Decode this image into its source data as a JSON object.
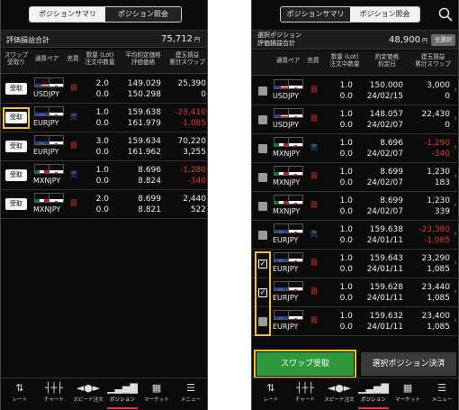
{
  "colors": {
    "buy": "#e53935",
    "sell": "#5c7bd9",
    "negative": "#e53935",
    "highlight": "#f6c417",
    "primary_button": "#2f9a3c"
  },
  "left": {
    "tabs": [
      {
        "label": "ポジションサマリ",
        "active": true
      },
      {
        "label": "ポジション照会",
        "active": false
      }
    ],
    "summary": {
      "label": "評価損益合計",
      "value": "75,712",
      "unit": "円"
    },
    "headers": {
      "swap": [
        "スワップ",
        "受取り"
      ],
      "pair": "通貨ペア",
      "side": "売買",
      "qty": [
        "数量 (Lot)",
        "注文中数量"
      ],
      "price": [
        "平均約定価格",
        "評価価格"
      ],
      "pl": [
        "建玉損益",
        "累計スワップ"
      ]
    },
    "rows": [
      {
        "button": "受取",
        "pair": "USDJPY",
        "flags": [
          "us",
          "jp"
        ],
        "side": "買",
        "side_type": "buy",
        "qty": "2.0",
        "pending": "0.0",
        "price1": "149.029",
        "price2": "150.298",
        "pl": "25,390",
        "swap": "0",
        "pl_neg": false,
        "swap_neg": false,
        "highlighted": false
      },
      {
        "button": "受取",
        "pair": "EURJPY",
        "flags": [
          "eu",
          "jp"
        ],
        "side": "売",
        "side_type": "sell",
        "qty": "1.0",
        "pending": "0.0",
        "price1": "159.638",
        "price2": "161.979",
        "pl": "-23,410",
        "swap": "-1,085",
        "pl_neg": true,
        "swap_neg": true,
        "highlighted": true
      },
      {
        "button": "受取",
        "pair": "EURJPY",
        "flags": [
          "eu",
          "jp"
        ],
        "side": "買",
        "side_type": "buy",
        "qty": "3.0",
        "pending": "0.0",
        "price1": "159.634",
        "price2": "161.962",
        "pl": "70,220",
        "swap": "3,255",
        "pl_neg": false,
        "swap_neg": false,
        "highlighted": false
      },
      {
        "button": "受取",
        "pair": "MXNJPY",
        "flags": [
          "mx",
          "jp"
        ],
        "side": "売",
        "side_type": "sell",
        "qty": "1.0",
        "pending": "0.0",
        "price1": "8.696",
        "price2": "8.824",
        "pl": "-1,280",
        "swap": "-340",
        "pl_neg": true,
        "swap_neg": true,
        "highlighted": false
      },
      {
        "button": "受取",
        "pair": "MXNJPY",
        "flags": [
          "mx",
          "jp"
        ],
        "side": "買",
        "side_type": "buy",
        "qty": "2.0",
        "pending": "0.0",
        "price1": "8.699",
        "price2": "8.821",
        "pl": "2,440",
        "swap": "522",
        "pl_neg": false,
        "swap_neg": false,
        "highlighted": false
      }
    ]
  },
  "right": {
    "tabs": [
      {
        "label": "ポジションサマリ",
        "active": false
      },
      {
        "label": "ポジション照会",
        "active": true
      }
    ],
    "search_icon": "search-icon",
    "summary": {
      "label1": "選択ポジション",
      "label2": "評価損益合計",
      "value": "48,900",
      "unit": "円",
      "select_all": "全選択"
    },
    "headers": {
      "pair": "通貨ペア",
      "side": "売買",
      "qty": [
        "数量 (Lot)",
        "注文中数量"
      ],
      "price": [
        "約定価格",
        "約定日"
      ],
      "pl": [
        "建玉損益",
        "累計スワップ"
      ]
    },
    "rows": [
      {
        "pair": "USDJPY",
        "flags": [
          "us",
          "jp"
        ],
        "side": "買",
        "side_type": "buy",
        "qty": "1.0",
        "pending": "0.0",
        "price": "150.000",
        "date": "24/02/15",
        "pl": "3,000",
        "swap": "0",
        "pl_neg": false,
        "swap_neg": false,
        "checked": false
      },
      {
        "pair": "USDJPY",
        "flags": [
          "us",
          "jp"
        ],
        "side": "買",
        "side_type": "buy",
        "qty": "1.0",
        "pending": "0.0",
        "price": "148.057",
        "date": "24/02/07",
        "pl": "22,430",
        "swap": "0",
        "pl_neg": false,
        "swap_neg": false,
        "checked": false
      },
      {
        "pair": "MXNJPY",
        "flags": [
          "mx",
          "jp"
        ],
        "side": "売",
        "side_type": "sell",
        "qty": "1.0",
        "pending": "0.0",
        "price": "8.696",
        "date": "24/02/07",
        "pl": "-1,290",
        "swap": "-340",
        "pl_neg": true,
        "swap_neg": true,
        "checked": false
      },
      {
        "pair": "MXNJPY",
        "flags": [
          "mx",
          "jp"
        ],
        "side": "買",
        "side_type": "buy",
        "qty": "1.0",
        "pending": "0.0",
        "price": "8.699",
        "date": "24/02/07",
        "pl": "1,230",
        "swap": "183",
        "pl_neg": false,
        "swap_neg": false,
        "checked": false
      },
      {
        "pair": "MXNJPY",
        "flags": [
          "mx",
          "jp"
        ],
        "side": "買",
        "side_type": "buy",
        "qty": "1.0",
        "pending": "0.0",
        "price": "8.699",
        "date": "24/02/07",
        "pl": "1,230",
        "swap": "339",
        "pl_neg": false,
        "swap_neg": false,
        "checked": false
      },
      {
        "pair": "EURJPY",
        "flags": [
          "eu",
          "jp"
        ],
        "side": "売",
        "side_type": "sell",
        "qty": "1.0",
        "pending": "0.0",
        "price": "159.638",
        "date": "24/01/11",
        "pl": "-23,380",
        "swap": "-1,085",
        "pl_neg": true,
        "swap_neg": true,
        "checked": false
      },
      {
        "pair": "EURJPY",
        "flags": [
          "eu",
          "jp"
        ],
        "side": "買",
        "side_type": "buy",
        "qty": "1.0",
        "pending": "0.0",
        "price": "159.643",
        "date": "24/01/11",
        "pl": "23,290",
        "swap": "1,085",
        "pl_neg": false,
        "swap_neg": false,
        "checked": true
      },
      {
        "pair": "EURJPY",
        "flags": [
          "eu",
          "jp"
        ],
        "side": "買",
        "side_type": "buy",
        "qty": "1.0",
        "pending": "0.0",
        "price": "159.628",
        "date": "24/01/11",
        "pl": "23,440",
        "swap": "1,085",
        "pl_neg": false,
        "swap_neg": false,
        "checked": true
      },
      {
        "pair": "EURJPY",
        "flags": [
          "eu",
          "jp"
        ],
        "side": "買",
        "side_type": "buy",
        "qty": "1.0",
        "pending": "0.0",
        "price": "159.632",
        "date": "24/01/11",
        "pl": "23,400",
        "swap": "1,085",
        "pl_neg": false,
        "swap_neg": false,
        "checked": false
      }
    ],
    "actions": {
      "swap_receive": "スワップ受取",
      "close_selected": "選択ポジション決済"
    }
  },
  "nav": [
    {
      "label": "レート",
      "icon": "rate-arrows-icon",
      "glyph": "⇅",
      "active": false
    },
    {
      "label": "チャート",
      "icon": "chart-candles-icon",
      "glyph": "┤┼├",
      "active": false
    },
    {
      "label": "スピード注文",
      "icon": "speed-order-icon",
      "glyph": "◄●►",
      "active": false
    },
    {
      "label": "ポジション",
      "icon": "position-bars-icon",
      "glyph": "▁▃▅▇",
      "active": true
    },
    {
      "label": "マーケット",
      "icon": "market-icon",
      "glyph": "▦",
      "active": false
    },
    {
      "label": "メニュー",
      "icon": "menu-icon",
      "glyph": "☰",
      "active": false
    }
  ]
}
